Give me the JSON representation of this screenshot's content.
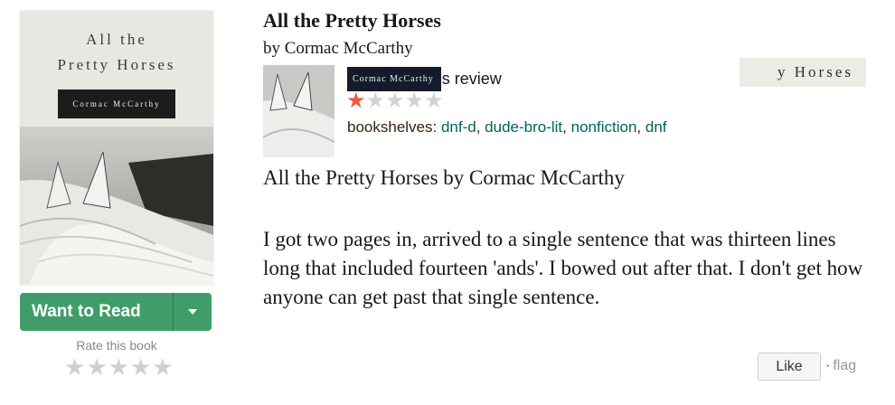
{
  "cover": {
    "title_line1": "All the",
    "title_line2": "Pretty Horses",
    "author": "Cormac McCarthy"
  },
  "actions": {
    "want_to_read": "Want to Read",
    "rate_label": "Rate this book",
    "rate_stars": [
      "★",
      "★",
      "★",
      "★",
      "★"
    ]
  },
  "book": {
    "title": "All the Pretty Horses",
    "author_line": "by Cormac McCarthy"
  },
  "review": {
    "reviewer_redacted": "Cormac McCarthy",
    "reviewer_suffix": "s review",
    "rating": 1,
    "stars_max": 5,
    "shelves_label": "bookshelves:",
    "shelves": [
      "dnf-d",
      "dude-bro-lit",
      "nonfiction",
      "dnf"
    ],
    "banner_text": "y Horses",
    "heading": "All the Pretty Horses by Cormac McCarthy",
    "body": "I got two pages in, arrived to a single sentence that was thirteen lines long that included fourteen 'ands'. I bowed out after that. I don't get how anyone can get past that single sentence.",
    "like_label": "Like",
    "flag_label": "flag"
  },
  "colors": {
    "accent_green": "#409d69",
    "link_teal": "#00635d",
    "star_rated": "#e95c3c"
  }
}
